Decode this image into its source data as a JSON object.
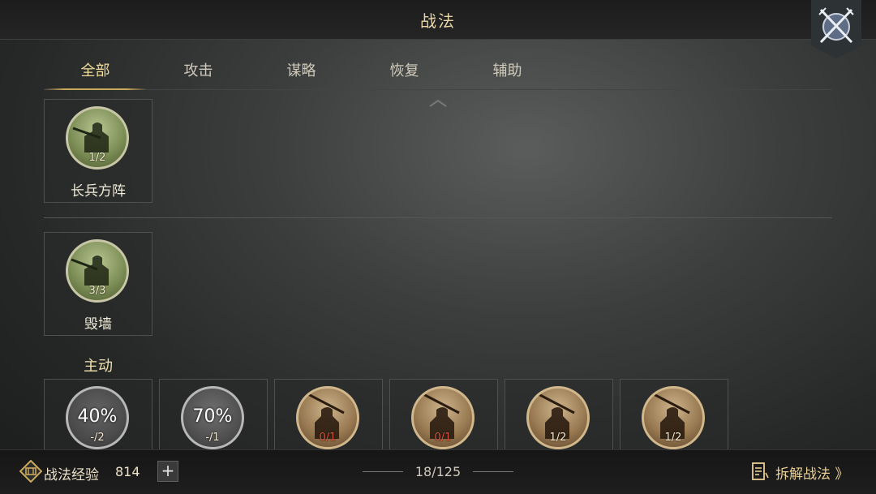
{
  "header": {
    "title": "战法"
  },
  "tabs": [
    {
      "label": "全部",
      "active": true
    },
    {
      "label": "攻击",
      "active": false
    },
    {
      "label": "谋略",
      "active": false
    },
    {
      "label": "恢复",
      "active": false
    },
    {
      "label": "辅助",
      "active": false
    }
  ],
  "sections": {
    "first": {
      "cards": [
        {
          "name": "长兵方阵",
          "count": "1/2"
        }
      ]
    },
    "second": {
      "cards": [
        {
          "name": "毁墙",
          "count": "3/3"
        }
      ]
    },
    "active": {
      "label": "主动",
      "cards": [
        {
          "percent": "40%",
          "count": "-/2"
        },
        {
          "percent": "70%",
          "count": "-/1"
        },
        {
          "count": "0/1"
        },
        {
          "count": "0/1"
        },
        {
          "count": "1/2"
        },
        {
          "count": "1/2"
        }
      ]
    }
  },
  "footer": {
    "exp_label": "战法经验",
    "exp_value": "814",
    "add_label": "+",
    "counter": "18/125",
    "dismantle_label": "拆解战法 》"
  },
  "colors": {
    "accent_gold": "#c9a95a",
    "red_count": "#d8563e"
  }
}
